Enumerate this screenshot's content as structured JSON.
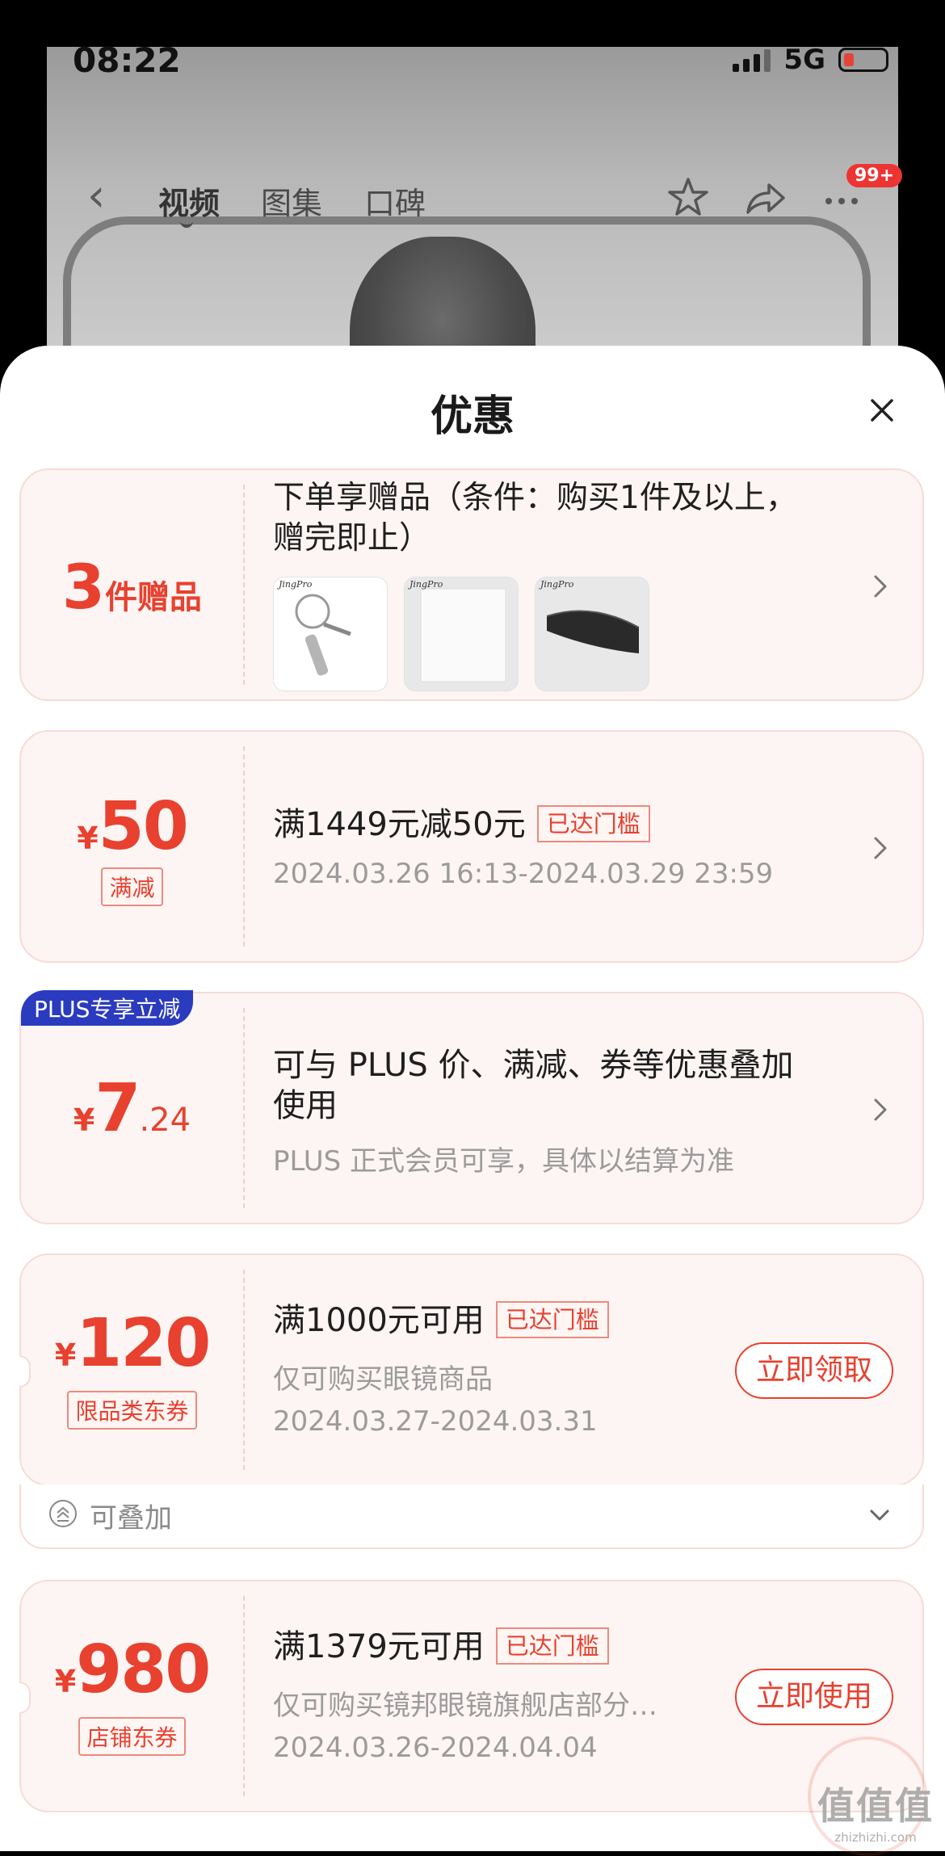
{
  "status_bar": {
    "time": "08:22",
    "network": "5G"
  },
  "nav": {
    "tabs": [
      "视频",
      "图集",
      "口碑"
    ],
    "badge": "99+"
  },
  "sheet": {
    "title": "优惠",
    "gift": {
      "count": "3",
      "count_suffix": "件赠品",
      "title": "下单享赠品（条件：购买1件及以上，赠完即止）",
      "title_line1": "下单享赠品（条件：购买1件及以上，",
      "title_line2": "赠完即止）",
      "thumb_brand": "JingPro"
    },
    "full_reduction": {
      "yen": "¥",
      "amount": "50",
      "tag": "满减",
      "title": "满1449元减50元",
      "reached": "已达门槛",
      "period": "2024.03.26 16:13-2024.03.29 23:59"
    },
    "plus": {
      "badge": "PLUS专享立减",
      "yen": "¥",
      "amount_int": "7",
      "amount_dec": ".24",
      "line1": "可与 PLUS 价、满减、券等优惠叠加",
      "line2": "使用",
      "sub": "PLUS 正式会员可享，具体以结算为准"
    },
    "coupon1": {
      "yen": "¥",
      "amount": "120",
      "tag": "限品类东券",
      "title": "满1000元可用",
      "reached": "已达门槛",
      "scope": "仅可购买眼镜商品",
      "period": "2024.03.27-2024.03.31",
      "button": "立即领取",
      "stackable": "可叠加"
    },
    "coupon2": {
      "yen": "¥",
      "amount": "980",
      "tag": "店铺东券",
      "title": "满1379元可用",
      "reached": "已达门槛",
      "scope": "仅可购买镜邦眼镜旗舰店部分…",
      "period": "2024.03.26-2024.04.04",
      "button": "立即使用"
    }
  },
  "watermark": {
    "logo": "值值值",
    "url": "zhizhizhi.com"
  },
  "colors": {
    "accent": "#e8412f",
    "plus_blue": "#2a3bbf",
    "card_bg": "#fdf5f3"
  }
}
